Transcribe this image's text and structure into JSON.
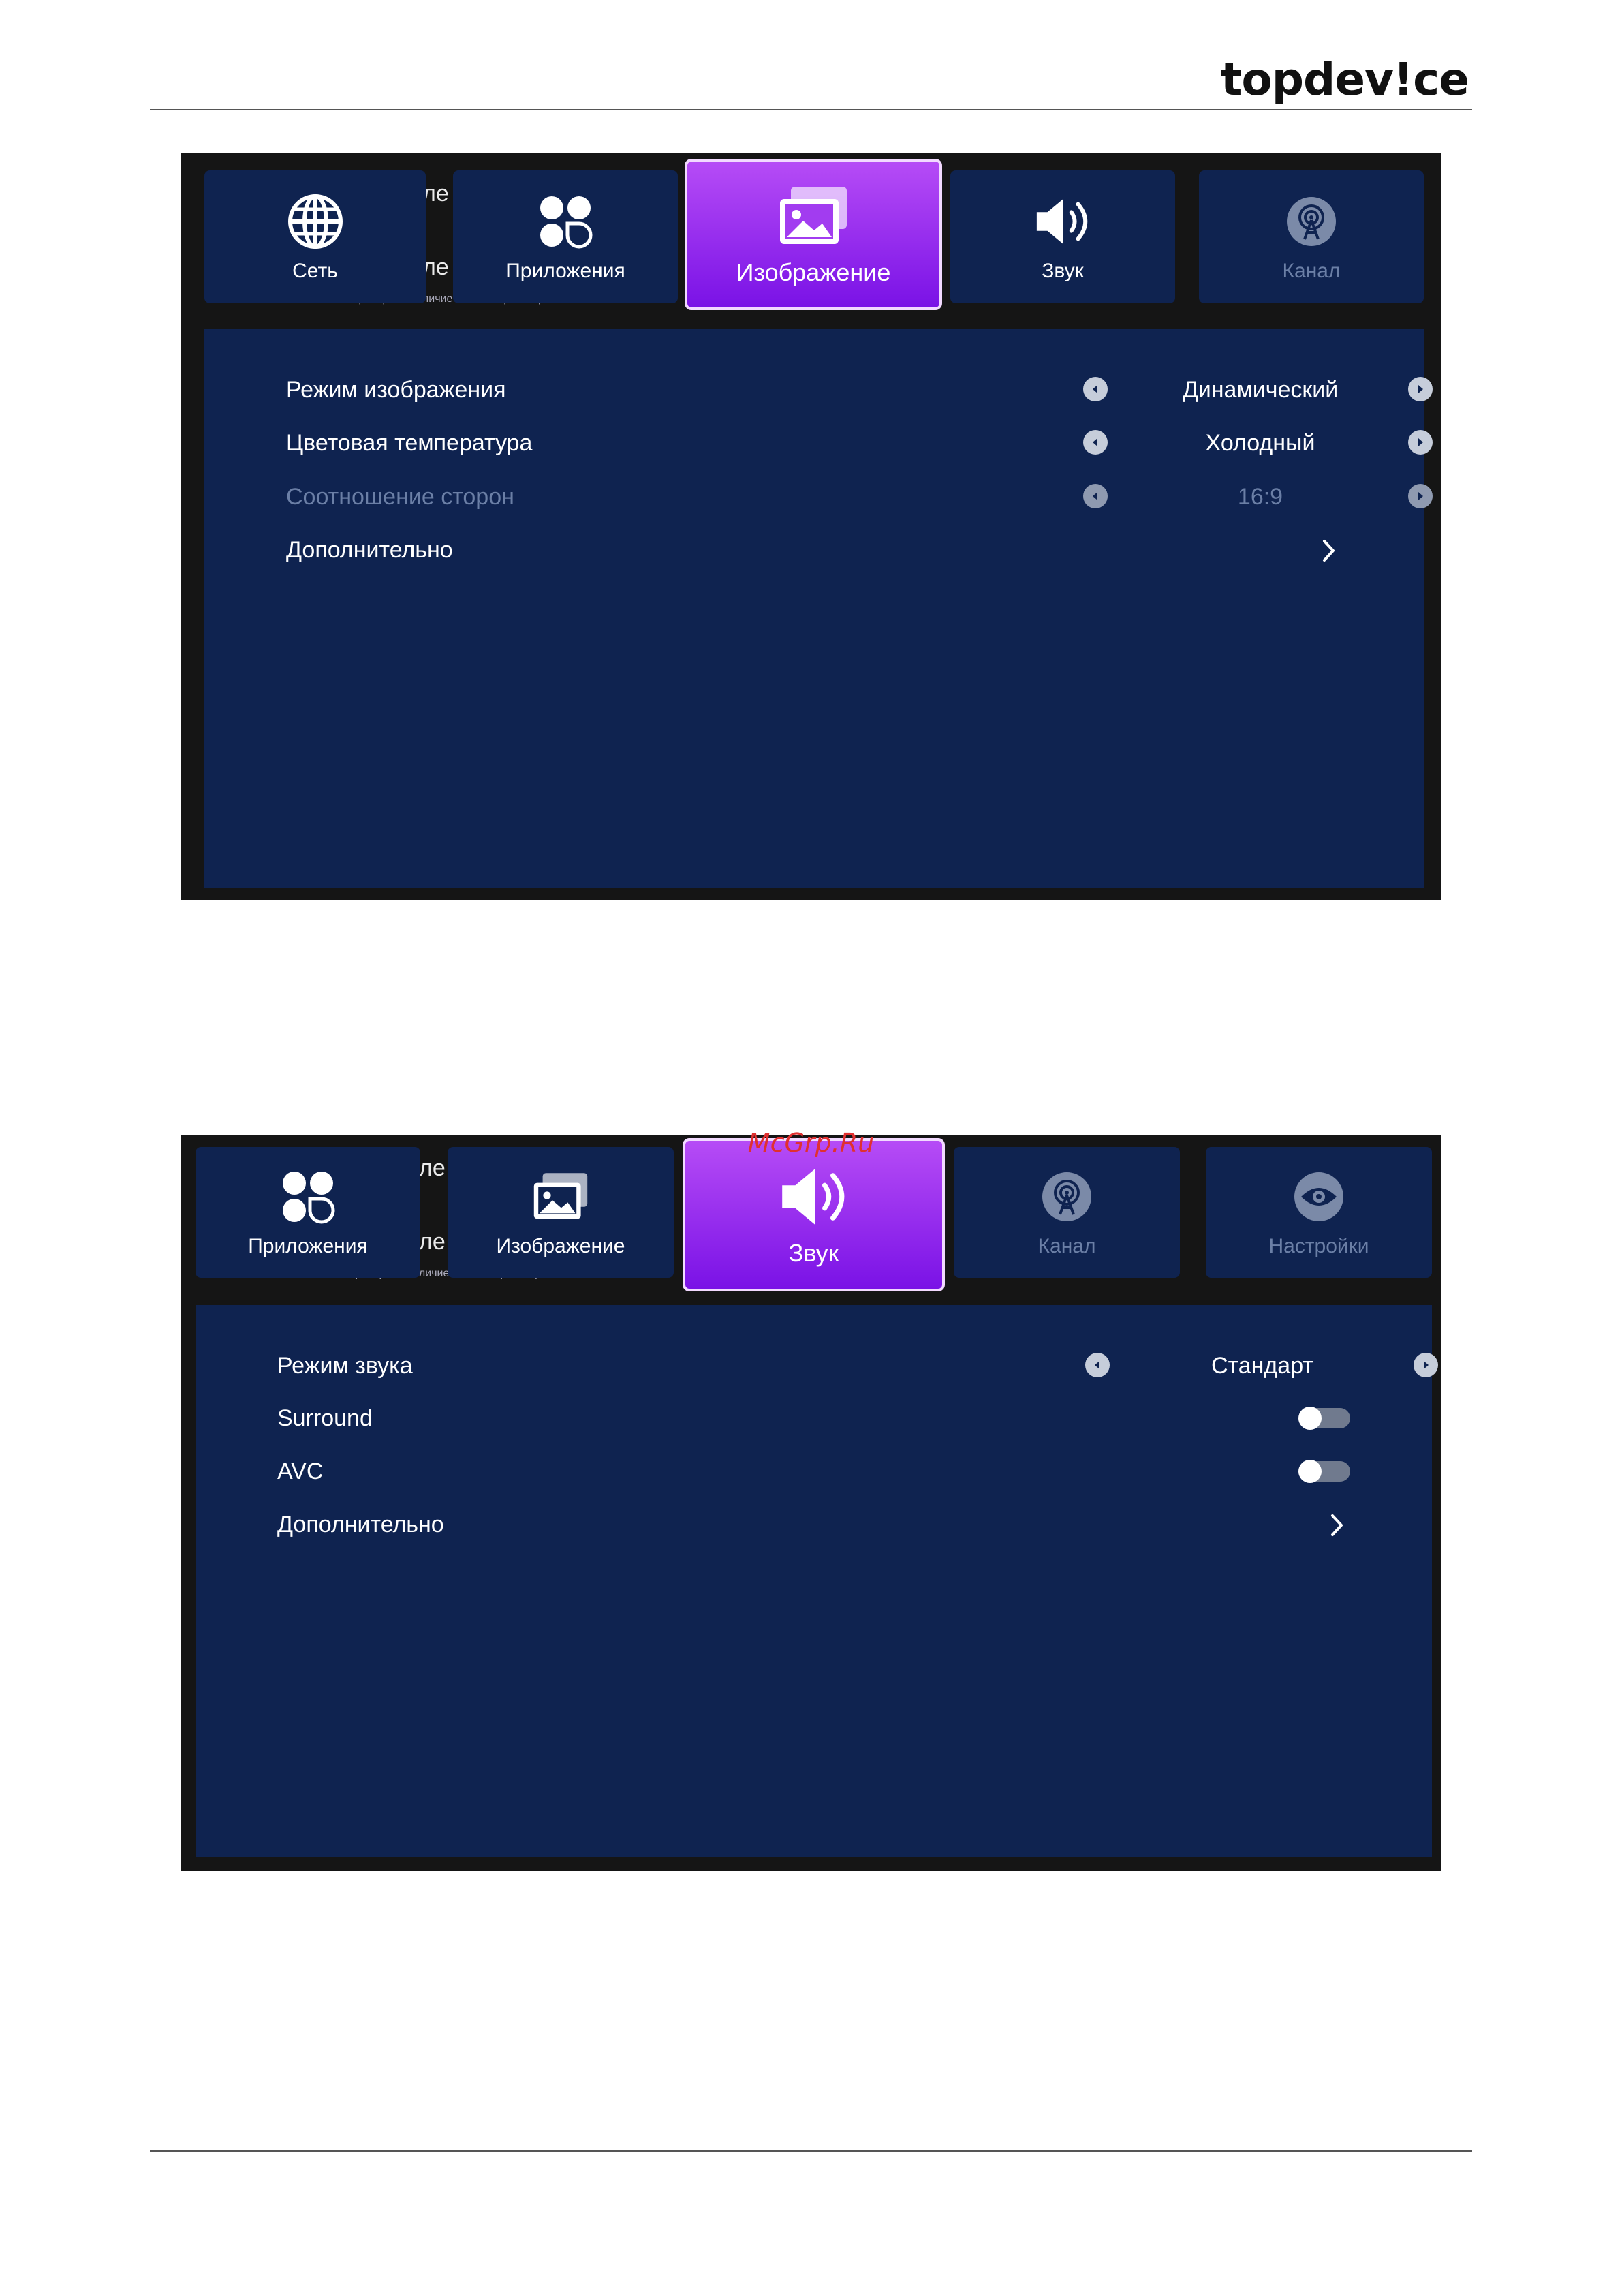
{
  "brand": "topdev!ce",
  "watermark": "McGrp.Ru",
  "background_fragments": {
    "top": "ле",
    "bottom": "ле",
    "small": "Проверить Наличие Новой Версии Прошивки"
  },
  "picture_screen": {
    "tabs": [
      {
        "label": "Сеть",
        "icon": "globe-icon",
        "state": "normal"
      },
      {
        "label": "Приложения",
        "icon": "apps-icon",
        "state": "normal"
      },
      {
        "label": "Изображение",
        "icon": "picture-icon",
        "state": "active"
      },
      {
        "label": "Звук",
        "icon": "speaker-icon",
        "state": "normal"
      },
      {
        "label": "Канал",
        "icon": "antenna-icon",
        "state": "dim"
      }
    ],
    "rows": [
      {
        "label": "Режим изображения",
        "value": "Динамический",
        "type": "select"
      },
      {
        "label": "Цветовая температура",
        "value": "Холодный",
        "type": "select"
      },
      {
        "label": "Соотношение сторон",
        "value": "16:9",
        "type": "select",
        "disabled": true
      },
      {
        "label": "Дополнительно",
        "type": "submenu"
      }
    ]
  },
  "sound_screen": {
    "tabs": [
      {
        "label": "Приложения",
        "icon": "apps-icon",
        "state": "normal"
      },
      {
        "label": "Изображение",
        "icon": "picture-icon",
        "state": "normal"
      },
      {
        "label": "Звук",
        "icon": "speaker-icon",
        "state": "active"
      },
      {
        "label": "Канал",
        "icon": "antenna-icon",
        "state": "dim"
      },
      {
        "label": "Настройки",
        "icon": "eye-icon",
        "state": "dim"
      }
    ],
    "rows": [
      {
        "label": "Режим звука",
        "value": "Стандарт",
        "type": "select"
      },
      {
        "label": "Surround",
        "type": "toggle",
        "on": false
      },
      {
        "label": "AVC",
        "type": "toggle",
        "on": false
      },
      {
        "label": "Дополнительно",
        "type": "submenu"
      }
    ]
  },
  "colors": {
    "panel": "#0f2350",
    "frame": "#151515",
    "accent_top": "#b64cf6",
    "accent_bottom": "#7a12e6",
    "disabled_text": "#6b7fa6"
  }
}
